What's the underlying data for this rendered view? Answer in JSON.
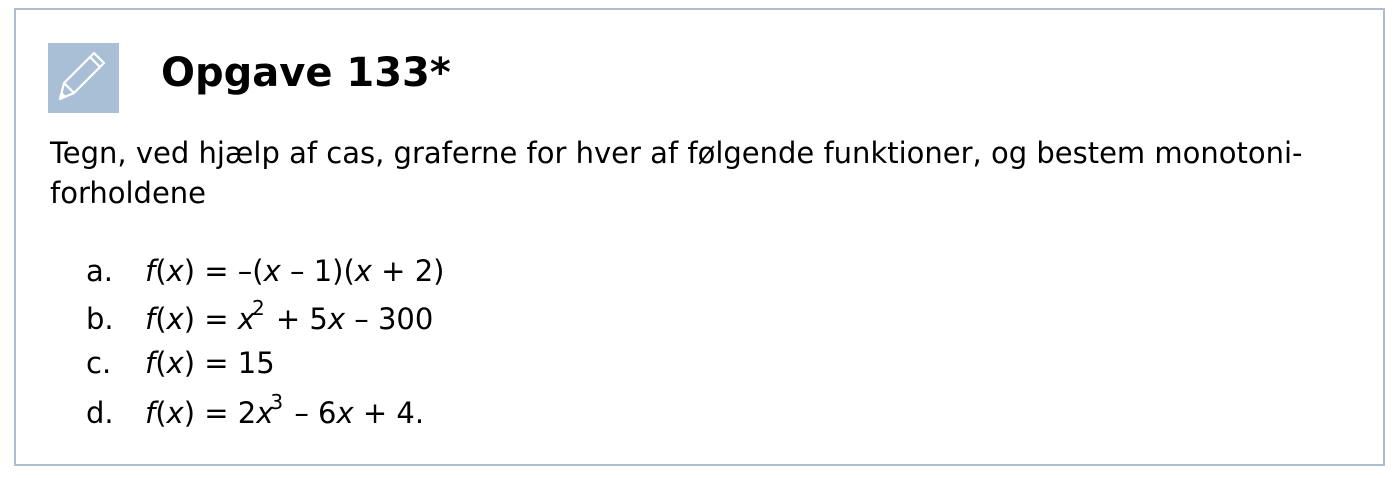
{
  "header": {
    "title": "Opgave 133*",
    "icon": "pencil-icon"
  },
  "colors": {
    "border": "#adbfcf",
    "icon_bg": "#a9bfd6"
  },
  "intro": {
    "line1": "Tegn, ved hjælp af cas, graferne for hver af følgende funktioner, og bestem monotoni-",
    "line2": "forholdene"
  },
  "items": [
    {
      "letter": "a.",
      "formula": "f(x) = –(x – 1)(x + 2)"
    },
    {
      "letter": "b.",
      "formula": "f(x) = x^2 + 5x – 300"
    },
    {
      "letter": "c.",
      "formula": "f(x) = 15"
    },
    {
      "letter": "d.",
      "formula": "f(x) = 2x^3 – 6x + 4."
    }
  ]
}
